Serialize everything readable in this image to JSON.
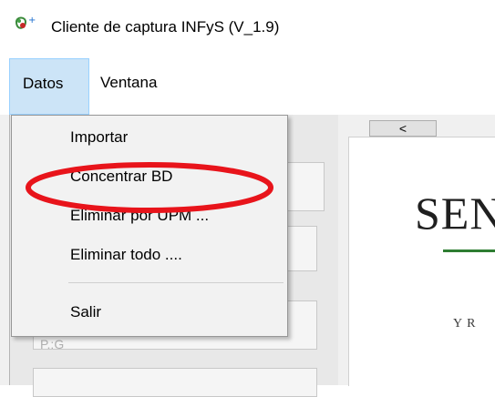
{
  "window": {
    "title": "Cliente de captura INFyS   (V_1.9)"
  },
  "menubar": {
    "datos": "Datos",
    "ventana": "Ventana"
  },
  "dropdown": {
    "items": [
      {
        "label": "Importar"
      },
      {
        "label": "Concentrar BD"
      },
      {
        "label": "Eliminar por UPM ..."
      },
      {
        "label": "Eliminar todo ...."
      },
      {
        "label": "Salir"
      }
    ]
  },
  "background": {
    "scroll_button": "<",
    "logo_text": "SEN",
    "logo_subtext": "Y R",
    "faded_label": "P.:G"
  },
  "colors": {
    "menu_highlight": "#cce4f7",
    "annotation_red": "#e8141b",
    "logo_green": "#2e7d32"
  }
}
